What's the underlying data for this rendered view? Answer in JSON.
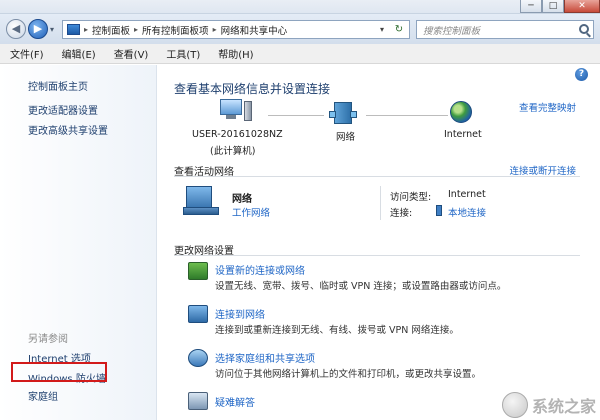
{
  "window": {
    "min_glyph": "─",
    "max_glyph": "□",
    "close_glyph": "✕"
  },
  "nav": {
    "back_glyph": "◀",
    "forward_glyph": "▶",
    "history_glyph": "▾",
    "breadcrumb": [
      "控制面板",
      "所有控制面板项",
      "网络和共享中心"
    ],
    "crumb_sep": "▸",
    "refresh_glyph": "↻",
    "search_placeholder": "搜索控制面板"
  },
  "menu": [
    "文件(F)",
    "编辑(E)",
    "查看(V)",
    "工具(T)",
    "帮助(H)"
  ],
  "sidebar": {
    "home": "控制面板主页",
    "links": [
      "更改适配器设置",
      "更改高级共享设置"
    ],
    "see_also_title": "另请参阅",
    "see_also": [
      "Internet 选项",
      "Windows 防火墙",
      "家庭组"
    ]
  },
  "main": {
    "help_glyph": "?",
    "title": "查看基本网络信息并设置连接",
    "full_map_link": "查看完整映射",
    "map": {
      "computer_name": "USER-20161028NZ",
      "computer_sub": "(此计算机)",
      "network_label": "网络",
      "internet_label": "Internet"
    },
    "active_title": "查看活动网络",
    "connect_link": "连接或断开连接",
    "active_network": {
      "name": "网络",
      "type": "工作网络",
      "access_label": "访问类型:",
      "access_value": "Internet",
      "conn_label": "连接:",
      "conn_value": "本地连接"
    },
    "change_title": "更改网络设置",
    "tasks": [
      {
        "title": "设置新的连接或网络",
        "desc": "设置无线、宽带、拨号、临时或 VPN 连接；或设置路由器或访问点。"
      },
      {
        "title": "连接到网络",
        "desc": "连接到或重新连接到无线、有线、拨号或 VPN 网络连接。"
      },
      {
        "title": "选择家庭组和共享选项",
        "desc": "访问位于其他网络计算机上的文件和打印机，或更改共享设置。"
      },
      {
        "title": "疑难解答",
        "desc": ""
      }
    ]
  },
  "watermark": {
    "text": "系统之家"
  },
  "colors": {
    "link": "#1f66c6",
    "highlight": "#d21a1a"
  }
}
